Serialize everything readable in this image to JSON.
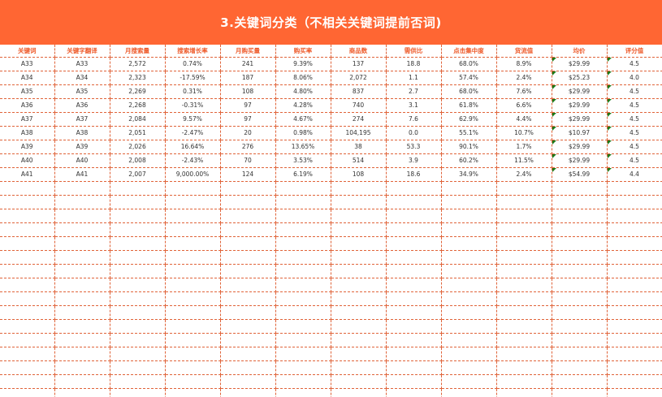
{
  "title": "3.关键词分类（不相关关键词提前否词)",
  "headers": [
    "关键词",
    "关键字翻译",
    "月搜索量",
    "搜索增长率",
    "月购买量",
    "购买率",
    "商品数",
    "需供比",
    "点击集中度",
    "货流值",
    "均价",
    "评分值"
  ],
  "rows": [
    [
      "A33",
      "A33",
      "2,572",
      "0.74%",
      "241",
      "9.39%",
      "137",
      "18.8",
      "68.0%",
      "8.9%",
      "$29.99",
      "4.5"
    ],
    [
      "A34",
      "A34",
      "2,323",
      "-17.59%",
      "187",
      "8.06%",
      "2,072",
      "1.1",
      "57.4%",
      "2.4%",
      "$25.23",
      "4.0"
    ],
    [
      "A35",
      "A35",
      "2,269",
      "0.31%",
      "108",
      "4.80%",
      "837",
      "2.7",
      "68.0%",
      "7.6%",
      "$29.99",
      "4.5"
    ],
    [
      "A36",
      "A36",
      "2,268",
      "-0.31%",
      "97",
      "4.28%",
      "740",
      "3.1",
      "61.8%",
      "6.6%",
      "$29.99",
      "4.5"
    ],
    [
      "A37",
      "A37",
      "2,084",
      "9.57%",
      "97",
      "4.67%",
      "274",
      "7.6",
      "62.9%",
      "4.4%",
      "$29.99",
      "4.5"
    ],
    [
      "A38",
      "A38",
      "2,051",
      "-2.47%",
      "20",
      "0.98%",
      "104,195",
      "0.0",
      "55.1%",
      "10.7%",
      "$10.97",
      "4.5"
    ],
    [
      "A39",
      "A39",
      "2,026",
      "16.64%",
      "276",
      "13.65%",
      "38",
      "53.3",
      "90.1%",
      "1.7%",
      "$29.99",
      "4.5"
    ],
    [
      "A40",
      "A40",
      "2,008",
      "-2.43%",
      "70",
      "3.53%",
      "514",
      "3.9",
      "60.2%",
      "11.5%",
      "$29.99",
      "4.5"
    ],
    [
      "A41",
      "A41",
      "2,007",
      "9,000.00%",
      "124",
      "6.19%",
      "108",
      "18.6",
      "34.9%",
      "2.4%",
      "$54.99",
      "4.4"
    ]
  ],
  "colors": {
    "banner": "#ff6633",
    "header_text": "#ee5a2a",
    "grid_line": "#e0643a",
    "note_flag": "#1a7a1a"
  }
}
